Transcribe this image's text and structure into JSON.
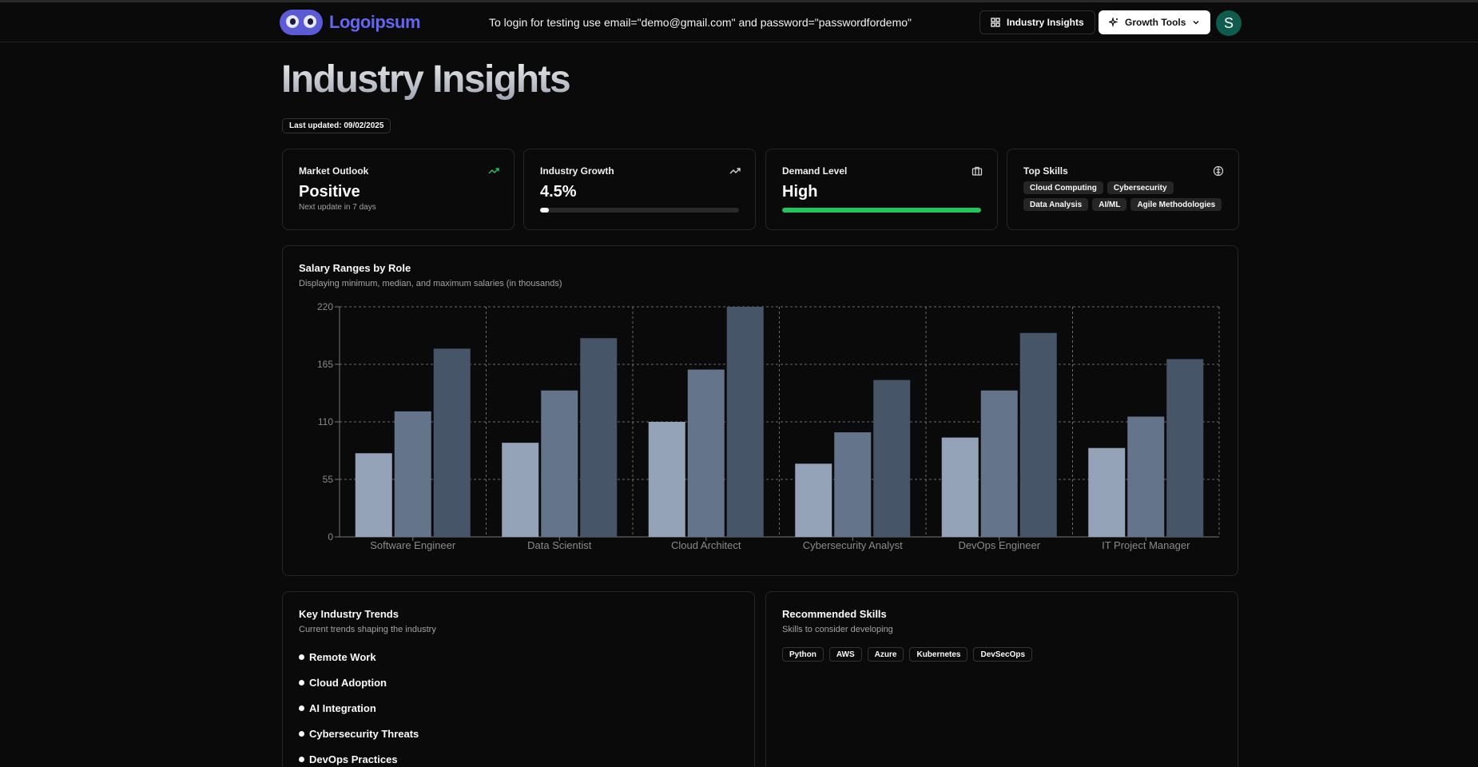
{
  "header": {
    "brand": "Logoipsum",
    "login_note": "To login for testing use email=\"demo@gmail.com\" and password=\"passwordfordemo\"",
    "insights_label": "Industry Insights",
    "growth_label": "Growth Tools",
    "avatar_initial": "S"
  },
  "page": {
    "title": "Industry Insights",
    "last_updated": "Last updated: 09/02/2025"
  },
  "stats": {
    "market": {
      "label": "Market Outlook",
      "value": "Positive",
      "sub": "Next update in 7 days"
    },
    "growth": {
      "label": "Industry Growth",
      "value": "4.5%",
      "progress": 0.045
    },
    "demand": {
      "label": "Demand Level",
      "value": "High",
      "progress": 1.0
    },
    "skills": {
      "label": "Top Skills",
      "items": [
        "Cloud Computing",
        "Cybersecurity",
        "Data Analysis",
        "AI/ML",
        "Agile Methodologies"
      ]
    }
  },
  "salary_card": {
    "title": "Salary Ranges by Role",
    "subtitle": "Displaying minimum, median, and maximum salaries (in thousands)"
  },
  "chart_data": {
    "type": "bar",
    "categories": [
      "Software Engineer",
      "Data Scientist",
      "Cloud Architect",
      "Cybersecurity Analyst",
      "DevOps Engineer",
      "IT Project Manager"
    ],
    "series": [
      {
        "values": [
          80,
          90,
          110,
          70,
          95,
          85
        ],
        "color": "#94a3b8"
      },
      {
        "values": [
          120,
          140,
          160,
          100,
          140,
          115
        ],
        "color": "#64748b"
      },
      {
        "values": [
          180,
          190,
          220,
          150,
          195,
          170
        ],
        "color": "#475569"
      }
    ],
    "yticks": [
      0,
      55,
      110,
      165,
      220
    ],
    "ylim": [
      0,
      220
    ],
    "grid": true
  },
  "trends": {
    "title": "Key Industry Trends",
    "subtitle": "Current trends shaping the industry",
    "items": [
      "Remote Work",
      "Cloud Adoption",
      "AI Integration",
      "Cybersecurity Threats",
      "DevOps Practices"
    ]
  },
  "recommended": {
    "title": "Recommended Skills",
    "subtitle": "Skills to consider developing",
    "items": [
      "Python",
      "AWS",
      "Azure",
      "Kubernetes",
      "DevSecOps"
    ]
  },
  "colors": {
    "accent_green": "#22c55e",
    "brand": "#6366f1"
  },
  "icons": {
    "market": "trending-up-icon",
    "growth": "trending-up-icon",
    "demand": "briefcase-icon",
    "skills": "brain-icon"
  }
}
